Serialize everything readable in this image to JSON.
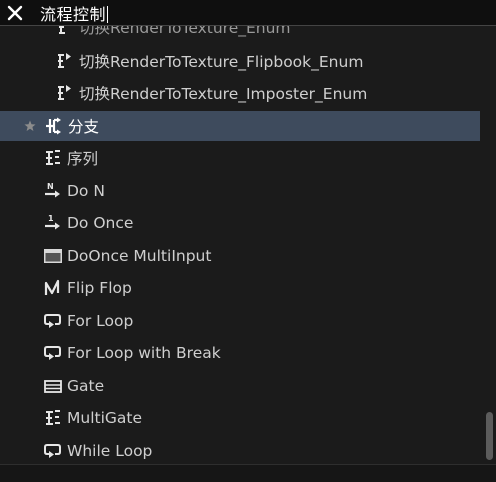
{
  "search": {
    "query": "流程控制",
    "clear_icon": "close-icon"
  },
  "items": [
    {
      "label": "切换RenderToTexture_Enum",
      "icon": "switch-node-icon"
    },
    {
      "label": "切换RenderToTexture_Flipbook_Enum",
      "icon": "switch-node-icon"
    },
    {
      "label": "切换RenderToTexture_Imposter_Enum",
      "icon": "switch-node-icon"
    },
    {
      "label": "分支",
      "icon": "branch-icon",
      "selected": true,
      "favorite_icon": "star-icon"
    },
    {
      "label": "序列",
      "icon": "sequence-icon"
    },
    {
      "label": "Do N",
      "icon": "do-n-icon"
    },
    {
      "label": "Do Once",
      "icon": "do-once-icon"
    },
    {
      "label": "DoOnce MultiInput",
      "icon": "do-once-multi-input-icon"
    },
    {
      "label": "Flip Flop",
      "icon": "flip-flop-icon"
    },
    {
      "label": "For Loop",
      "icon": "loop-icon"
    },
    {
      "label": "For Loop with Break",
      "icon": "loop-icon"
    },
    {
      "label": "Gate",
      "icon": "gate-icon"
    },
    {
      "label": "MultiGate",
      "icon": "sequence-icon"
    },
    {
      "label": "While Loop",
      "icon": "loop-icon"
    }
  ],
  "colors": {
    "background": "#1b1b1b",
    "selected_row": "#3e4b5d",
    "text": "#cfcfcf",
    "search_bg": "#0f0f0f"
  }
}
